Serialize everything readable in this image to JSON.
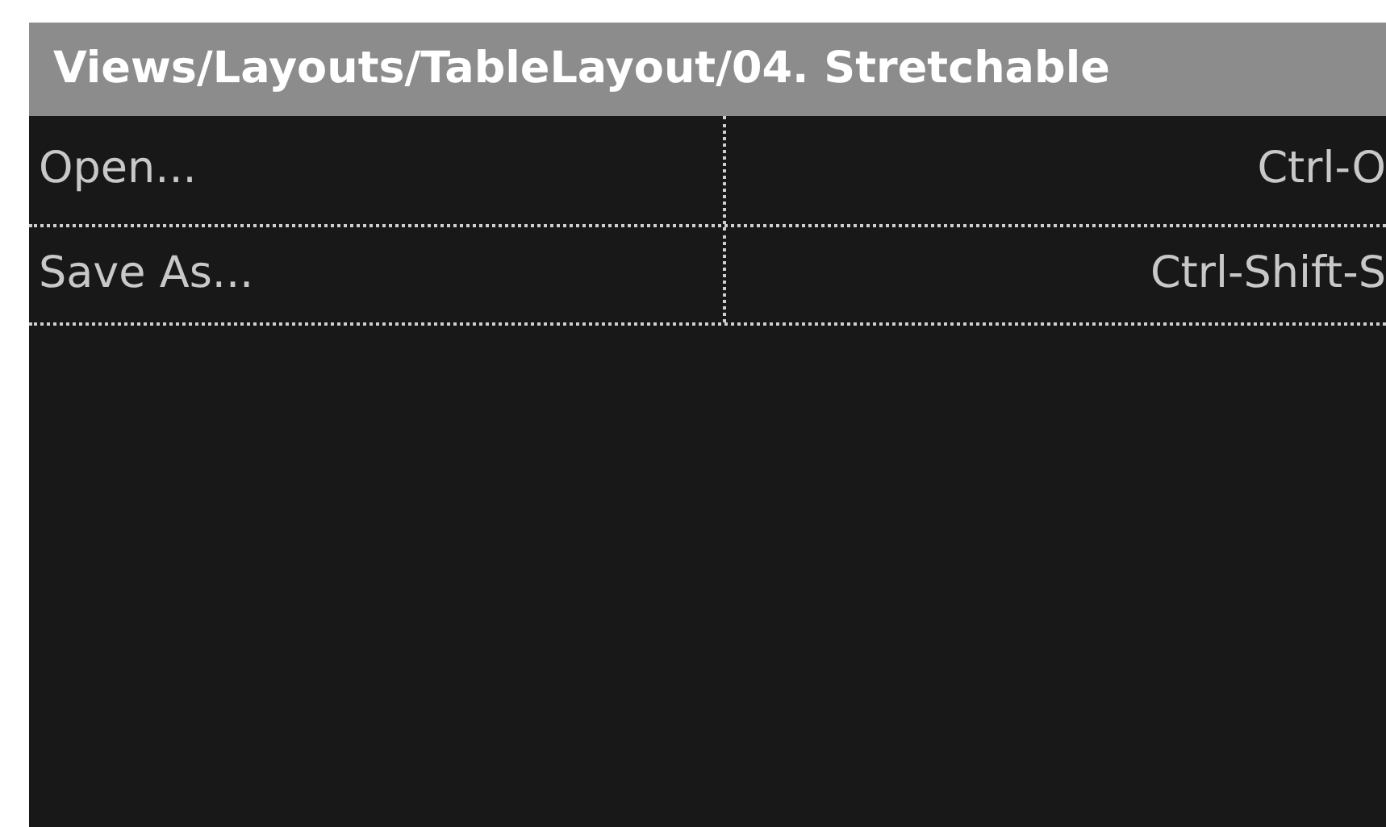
{
  "title_bar": {
    "title": "Views/Layouts/TableLayout/04. Stretchable"
  },
  "table": {
    "rows": [
      {
        "label": "Open...",
        "shortcut": "Ctrl-O"
      },
      {
        "label": "Save As...",
        "shortcut": "Ctrl-Shift-S"
      }
    ]
  }
}
